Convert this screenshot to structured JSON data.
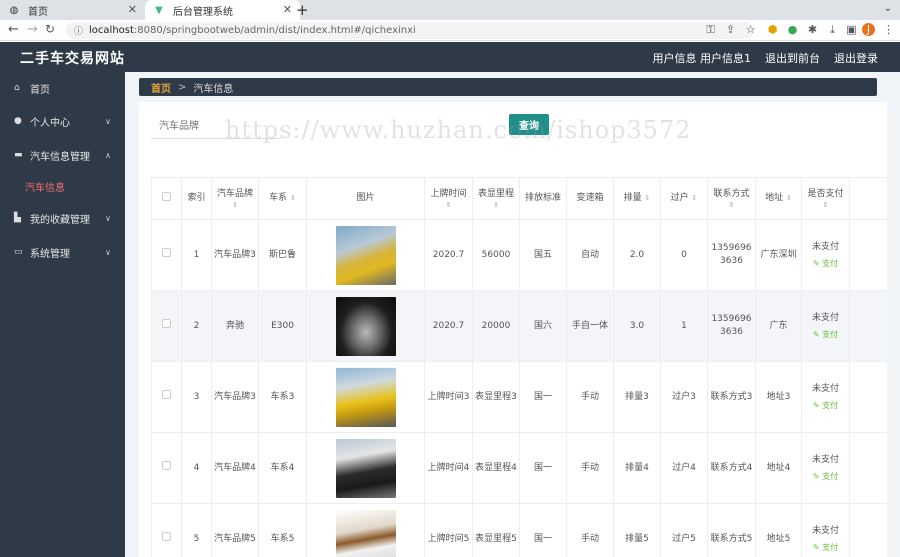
{
  "browser": {
    "tabs": [
      {
        "label": "首页"
      },
      {
        "label": "后台管理系统"
      }
    ],
    "url_host": "localhost",
    "url_path": ":8080/springbootweb/admin/dist/index.html#/qichexinxi"
  },
  "header": {
    "brand": "二手车交易网站",
    "links": [
      "用户信息 用户信息1",
      "退出到前台",
      "退出登录"
    ]
  },
  "sidebar": {
    "items": [
      {
        "label": "首页",
        "icon": "home-icon"
      },
      {
        "label": "个人中心",
        "icon": "user-icon"
      },
      {
        "label": "汽车信息管理",
        "icon": "folder-icon"
      },
      {
        "label": "汽车信息"
      },
      {
        "label": "我的收藏管理",
        "icon": "collection-icon"
      },
      {
        "label": "系统管理",
        "icon": "system-icon"
      }
    ]
  },
  "breadcrumb": {
    "home": "首页",
    "sep": ">",
    "current": "汽车信息"
  },
  "search": {
    "placeholder": "汽车品牌",
    "button": "查询"
  },
  "watermark": "https://www.huzhan.com/ishop3572",
  "table": {
    "headers": [
      "索引",
      "汽车品牌",
      "车系",
      "图片",
      "上牌时间",
      "表显里程",
      "排放标准",
      "变速箱",
      "排量",
      "过户",
      "联系方式",
      "地址",
      "是否支付"
    ],
    "rows": [
      {
        "idx": "1",
        "brand": "汽车品牌3",
        "series": "斯巴鲁",
        "time": "2020.7",
        "mileage": "56000",
        "emission": "国五",
        "gearbox": "自动",
        "displacement": "2.0",
        "transfer": "0",
        "contact": "13596963636",
        "address": "广东深圳",
        "paid": "未支付",
        "pay": "支付"
      },
      {
        "idx": "2",
        "brand": "奔驰",
        "series": "E300",
        "time": "2020.7",
        "mileage": "20000",
        "emission": "国六",
        "gearbox": "手自一体",
        "displacement": "3.0",
        "transfer": "1",
        "contact": "13596963636",
        "address": "广东",
        "paid": "未支付",
        "pay": "支付"
      },
      {
        "idx": "3",
        "brand": "汽车品牌3",
        "series": "车系3",
        "time": "上牌时间3",
        "mileage": "表显里程3",
        "emission": "国一",
        "gearbox": "手动",
        "displacement": "排量3",
        "transfer": "过户3",
        "contact": "联系方式3",
        "address": "地址3",
        "paid": "未支付",
        "pay": "支付"
      },
      {
        "idx": "4",
        "brand": "汽车品牌4",
        "series": "车系4",
        "time": "上牌时间4",
        "mileage": "表显里程4",
        "emission": "国一",
        "gearbox": "手动",
        "displacement": "排量4",
        "transfer": "过户4",
        "contact": "联系方式4",
        "address": "地址4",
        "paid": "未支付",
        "pay": "支付"
      },
      {
        "idx": "5",
        "brand": "汽车品牌5",
        "series": "车系5",
        "time": "上牌时间5",
        "mileage": "表显里程5",
        "emission": "国一",
        "gearbox": "手动",
        "displacement": "排量5",
        "transfer": "过户5",
        "contact": "联系方式5",
        "address": "地址5",
        "paid": "未支付",
        "pay": "支付"
      }
    ]
  },
  "colors": {
    "header_bg": "#2f3a48",
    "accent": "#e6a23c",
    "query_btn": "#1f8f8a",
    "active_menu": "#f56c6c",
    "pay_link": "#67c23a"
  }
}
